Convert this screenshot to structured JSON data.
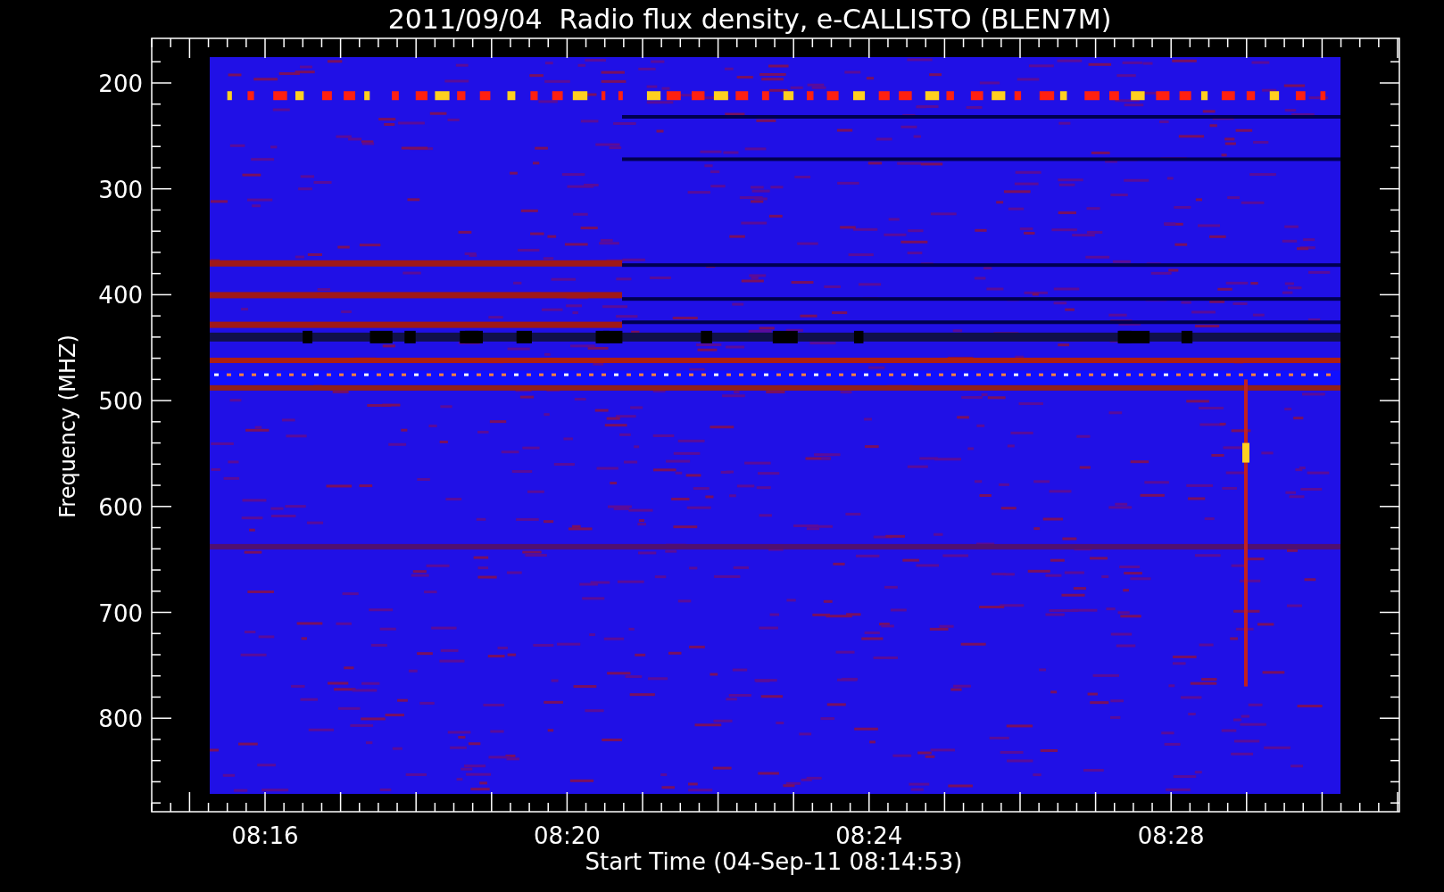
{
  "title": "2011/09/04  Radio flux density, e-CALLISTO (BLEN7M)",
  "y_axis": {
    "label": "Frequency (MHZ)",
    "ticks": [
      "200",
      "300",
      "400",
      "500",
      "600",
      "700",
      "800"
    ]
  },
  "x_axis": {
    "label": "Start Time (04-Sep-11 08:14:53)",
    "ticks": [
      "08:16",
      "08:20",
      "08:24",
      "08:28"
    ]
  }
}
